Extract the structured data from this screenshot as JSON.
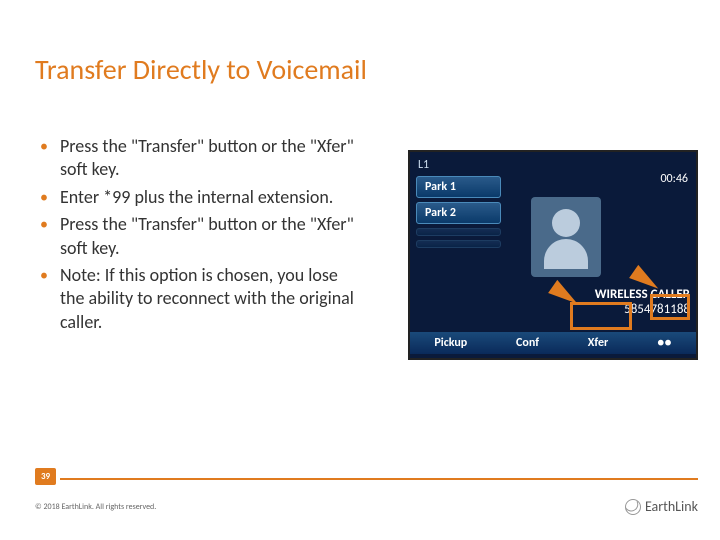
{
  "title": "Transfer Directly to Voicemail",
  "bullets": [
    "Press the \"Transfer\" button or the \"Xfer\" soft key.",
    "Enter *99 plus the internal extension.",
    "Press the \"Transfer\" button or the \"Xfer\" soft key.",
    "Note:  If this option is chosen, you lose the ability to reconnect with the original caller."
  ],
  "phone": {
    "line": "L1",
    "park1": "Park 1",
    "park2": "Park 2",
    "duration": "00:46",
    "caller_label": "WIRELESS CALLER",
    "caller_number": "5854781188",
    "softkeys": {
      "pickup": "Pickup",
      "conf": "Conf",
      "xfer": "Xfer",
      "more": "●●"
    }
  },
  "page_number": "39",
  "copyright": "© 2018 EarthLink. All rights reserved.",
  "logo_text": "EarthLink"
}
